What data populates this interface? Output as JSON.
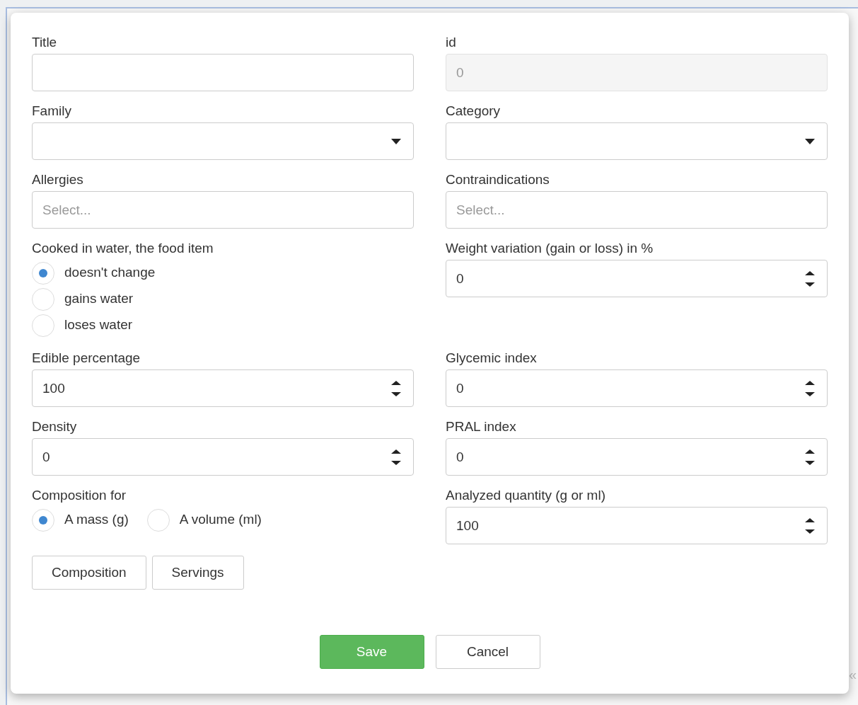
{
  "rows": [
    [
      {
        "kind": "text",
        "label": "Title",
        "disabled": false
      },
      {
        "kind": "text",
        "label": "id",
        "placeholder": "0",
        "disabled": true
      }
    ],
    [
      {
        "kind": "select",
        "label": "Family"
      },
      {
        "kind": "select",
        "label": "Category"
      }
    ],
    [
      {
        "kind": "multiselect",
        "label": "Allergies",
        "placeholder": "Select..."
      },
      {
        "kind": "multiselect",
        "label": "Contraindications",
        "placeholder": "Select..."
      }
    ],
    [
      {
        "kind": "radio_list",
        "label": "Cooked in water, the food item",
        "options": [
          {
            "label": "doesn't change",
            "selected": true
          },
          {
            "label": "gains water",
            "selected": false
          },
          {
            "label": "loses water",
            "selected": false
          }
        ]
      },
      {
        "kind": "number",
        "label": "Weight variation (gain or loss) in %",
        "value": "0"
      }
    ],
    [
      {
        "kind": "number",
        "label": "Edible percentage",
        "value": "100"
      },
      {
        "kind": "number",
        "label": "Glycemic index",
        "value": "0"
      }
    ],
    [
      {
        "kind": "number",
        "label": "Density",
        "value": "0"
      },
      {
        "kind": "number",
        "label": "PRAL index",
        "value": "0"
      }
    ],
    [
      {
        "kind": "radio_row",
        "label": "Composition for",
        "options": [
          {
            "label": "A mass (g)",
            "selected": true
          },
          {
            "label": "A volume (ml)",
            "selected": false
          }
        ]
      },
      {
        "kind": "number",
        "label": "Analyzed quantity (g or ml)",
        "value": "100"
      }
    ]
  ],
  "section_buttons": [
    "Composition",
    "Servings"
  ],
  "footer_buttons": [
    {
      "label": "Save",
      "kind": "primary"
    },
    {
      "label": "Cancel",
      "kind": "default"
    }
  ],
  "collapse_glyph": "«"
}
